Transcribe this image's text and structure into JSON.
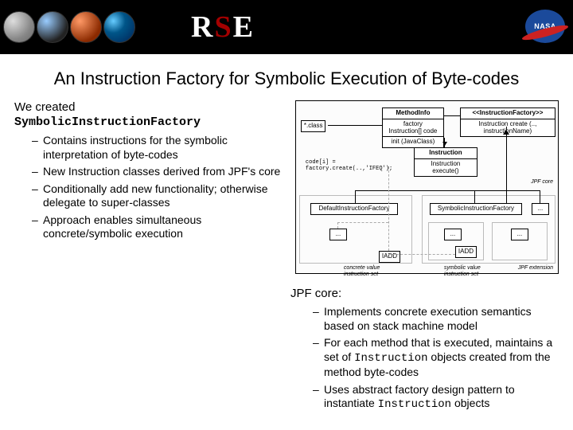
{
  "header": {
    "logo_text_pre": "R",
    "logo_text_mid": "S",
    "logo_text_post": "E",
    "nasa": "NASA"
  },
  "title": "An Instruction Factory for Symbolic Execution of Byte-codes",
  "left": {
    "intro": "We created",
    "classname": "SymbolicInstructionFactory",
    "bullets": [
      "Contains instructions for the symbolic interpretation of byte-codes",
      "New Instruction classes derived from JPF's core",
      "Conditionally add new functionality; otherwise delegate to super-classes",
      "Approach enables simultaneous concrete/symbolic execution"
    ]
  },
  "diagram": {
    "class_box": "*.class",
    "methodinfo": {
      "title": "MethodInfo",
      "l1": "factory",
      "l2": "Instruction[] code",
      "l3": "init (JavaClass)"
    },
    "instrfactory": {
      "stereo": "<<InstructionFactory>>",
      "m": "Instruction create (.., instructionName)"
    },
    "instruction": {
      "title": "Instruction",
      "m": "Instruction execute()"
    },
    "code_snippet": {
      "l1": "code[i] =",
      "l2": "  factory.create(..,'IFEQ');"
    },
    "default_factory": "DefaultInstructionFactory",
    "symbolic_factory": "SymbolicInstructionFactory",
    "dots": "...",
    "iadd": "IADD",
    "concrete_label": "concrete value\ninstruction set",
    "symbolic_label": "symbolic value\ninstruction set",
    "jpf_core": "JPF core",
    "jpf_ext": "JPF extension"
  },
  "lower": {
    "subhead": "JPF core:",
    "bullets": [
      {
        "pre": "Implements concrete execution semantics based on stack machine model"
      },
      {
        "pre": "For each method that is executed, maintains a set of ",
        "code": "Instruction",
        "post": " objects created from the method byte-codes"
      },
      {
        "pre": "Uses abstract factory design pattern to instantiate ",
        "code": "Instruction",
        "post": " objects"
      }
    ]
  }
}
